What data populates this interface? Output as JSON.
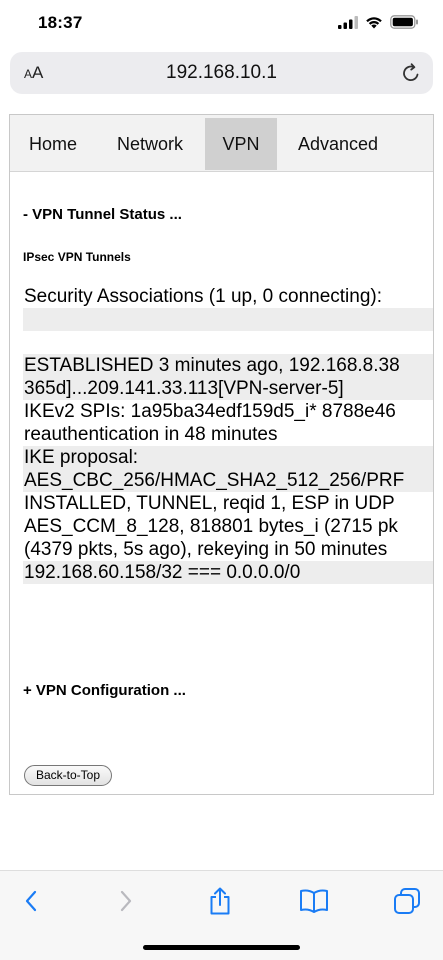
{
  "status_bar": {
    "time": "18:37"
  },
  "address_bar": {
    "aa_label_small": "A",
    "aa_label_large": "A",
    "url": "192.168.10.1"
  },
  "nav": {
    "items": [
      {
        "label": "Home",
        "active": false
      },
      {
        "label": "Network",
        "active": false
      },
      {
        "label": "VPN",
        "active": true
      },
      {
        "label": "Advanced",
        "active": false
      }
    ]
  },
  "content": {
    "tunnel_status_heading": "- VPN Tunnel Status ...",
    "ipsec_heading": "IPsec VPN Tunnels",
    "status_lines": [
      {
        "text": "Security Associations (1 up, 0 connecting):",
        "shaded": false
      },
      {
        "text": "",
        "shaded": true
      },
      {
        "text": "",
        "shaded": false
      },
      {
        "text": "ESTABLISHED 3 minutes ago, 192.168.8.38",
        "shaded": true
      },
      {
        "text": "365d]...209.141.33.113[VPN-server-5]",
        "shaded": true
      },
      {
        "text": "IKEv2 SPIs: 1a95ba34edf159d5_i* 8788e46",
        "shaded": false
      },
      {
        "text": "reauthentication in 48 minutes",
        "shaded": false
      },
      {
        "text": "IKE proposal:",
        "shaded": true
      },
      {
        "text": "AES_CBC_256/HMAC_SHA2_512_256/PRF",
        "shaded": true
      },
      {
        "text": "INSTALLED, TUNNEL, reqid 1, ESP in UDP",
        "shaded": false
      },
      {
        "text": "AES_CCM_8_128, 818801 bytes_i (2715 pk",
        "shaded": false
      },
      {
        "text": "(4379 pkts, 5s ago), rekeying in 50 minutes",
        "shaded": false
      },
      {
        "text": "192.168.60.158/32 === 0.0.0.0/0",
        "shaded": true
      }
    ],
    "vpn_config_heading": "+ VPN Configuration ...",
    "back_to_top_label": "Back-to-Top"
  },
  "icons": {
    "signal": "signal-icon",
    "wifi": "wifi-icon",
    "battery": "battery-icon",
    "reload": "reload-icon",
    "back": "chevron-left-icon",
    "forward": "chevron-right-icon",
    "share": "share-icon",
    "bookmarks": "book-icon",
    "tabs": "tabs-icon"
  },
  "colors": {
    "accent": "#1a7cf5",
    "disabled": "#b9b9be",
    "nav_active": "#d0d0d0",
    "shaded_line": "#ededed"
  }
}
